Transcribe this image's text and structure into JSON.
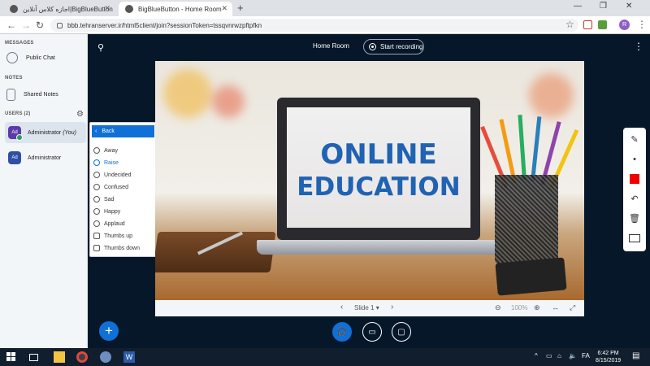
{
  "browser": {
    "tabs": [
      {
        "title": "اجازه کلاس آنلاین|BigBlueButton"
      },
      {
        "title": "BigBlueButton - Home Room"
      }
    ],
    "url": "bbb.tehranserver.ir/html5client/join?sessionToken=tssqvnrwzpftpfkn",
    "profile_initial": "R"
  },
  "sidebar": {
    "messages_title": "MESSAGES",
    "public_chat": "Public Chat",
    "notes_title": "NOTES",
    "shared_notes": "Shared Notes",
    "users_title": "USERS (2)",
    "users": [
      {
        "initials": "Ad",
        "name": "Administrator",
        "you_label": "(You)",
        "color": "#5c3aa9"
      },
      {
        "initials": "Ad",
        "name": "Administrator",
        "you_label": "",
        "color": "#2f4ea6"
      }
    ]
  },
  "status_menu": {
    "back_label": "Back",
    "items": [
      {
        "label": "Away",
        "icon": "clock-icon",
        "selected": false
      },
      {
        "label": "Raise",
        "icon": "hand-icon",
        "selected": true
      },
      {
        "label": "Undecided",
        "icon": "neutral-face-icon",
        "selected": false
      },
      {
        "label": "Confused",
        "icon": "confused-face-icon",
        "selected": false
      },
      {
        "label": "Sad",
        "icon": "sad-face-icon",
        "selected": false
      },
      {
        "label": "Happy",
        "icon": "happy-face-icon",
        "selected": false
      },
      {
        "label": "Applaud",
        "icon": "applaud-icon",
        "selected": false
      },
      {
        "label": "Thumbs up",
        "icon": "thumbs-up-icon",
        "selected": false
      },
      {
        "label": "Thumbs down",
        "icon": "thumbs-down-icon",
        "selected": false
      }
    ]
  },
  "header": {
    "room_title": "Home Room",
    "record_label": "Start recording"
  },
  "slide": {
    "line1": "ONLINE",
    "line2": "EDUCATION",
    "slide_label": "Slide 1",
    "zoom": "100%"
  },
  "taskbar": {
    "time": "6:42 PM",
    "date": "8/15/2019",
    "lang": "FA"
  },
  "colors": {
    "accent": "#0f70d7",
    "bg": "#06172a"
  }
}
